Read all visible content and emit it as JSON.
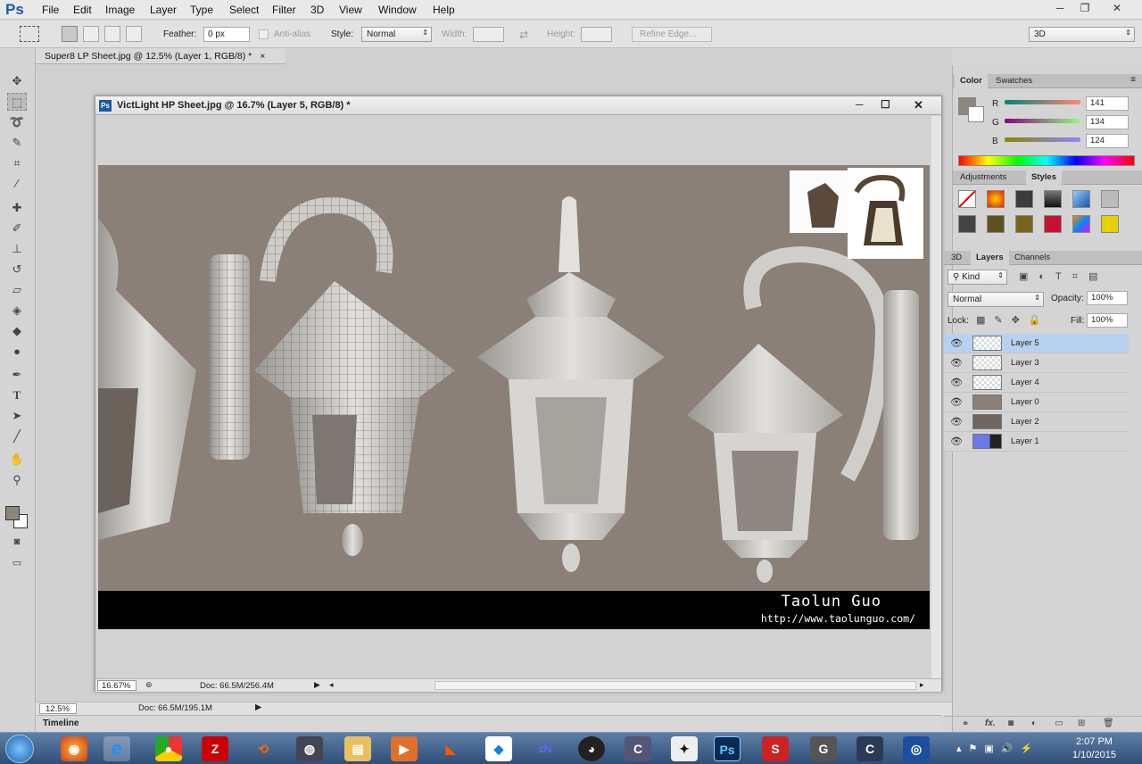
{
  "app": {
    "logo": "Ps"
  },
  "menu": [
    "File",
    "Edit",
    "Image",
    "Layer",
    "Type",
    "Select",
    "Filter",
    "3D",
    "View",
    "Window",
    "Help"
  ],
  "window_controls": {
    "minimize": "─",
    "restore": "❐",
    "close": "✕"
  },
  "options": {
    "feather_label": "Feather:",
    "feather_value": "0 px",
    "antialias_label": "Anti-alias",
    "style_label": "Style:",
    "style_value": "Normal",
    "width_label": "Width:",
    "height_label": "Height:",
    "refine_edge": "Refine Edge...",
    "workspace": "3D"
  },
  "back_doc_tab": "Super8 LP Sheet.jpg @ 12.5% (Layer 1, RGB/8) *",
  "doc_window": {
    "title": "VictLight HP Sheet.jpg @ 16.7% (Layer 5, RGB/8) *",
    "zoom": "16.67%",
    "doc_info": "Doc: 66.5M/256.4M"
  },
  "canvas_caption": {
    "name": "Taolun Guo",
    "url": "http://www.taolunguo.com/"
  },
  "status": {
    "zoom": "12.5%",
    "doc_info": "Doc: 66.5M/195.1M"
  },
  "timeline_label": "Timeline",
  "color_panel": {
    "tabs": [
      "Color",
      "Swatches"
    ],
    "r_label": "R",
    "g_label": "G",
    "b_label": "B",
    "r": "141",
    "g": "134",
    "b": "124",
    "foreground": "#8d867c"
  },
  "adjustments_panel": {
    "tabs": [
      "Adjustments",
      "Styles"
    ]
  },
  "layers_panel": {
    "tabs": [
      "3D",
      "Layers",
      "Channels"
    ],
    "kind": "Kind",
    "blend_mode": "Normal",
    "opacity_label": "Opacity:",
    "opacity": "100%",
    "lock_label": "Lock:",
    "fill_label": "Fill:",
    "fill": "100%",
    "layers": [
      "Layer 5",
      "Layer 3",
      "Layer 4",
      "Layer 0",
      "Layer 2",
      "Layer 1"
    ],
    "footer_fx": "fx."
  },
  "taskbar": {
    "time": "2:07 PM",
    "date": "1/10/2015"
  },
  "icons": [
    "marquee-icon",
    "move-icon",
    "lasso-icon",
    "quick-select-icon",
    "crop-icon",
    "eyedropper-icon",
    "healing-icon",
    "brush-icon",
    "stamp-icon",
    "history-brush-icon",
    "eraser-icon",
    "bucket-icon",
    "blur-icon",
    "dodge-icon",
    "pen-icon",
    "type-icon",
    "path-select-icon",
    "line-icon",
    "hand-icon",
    "zoom-icon"
  ]
}
